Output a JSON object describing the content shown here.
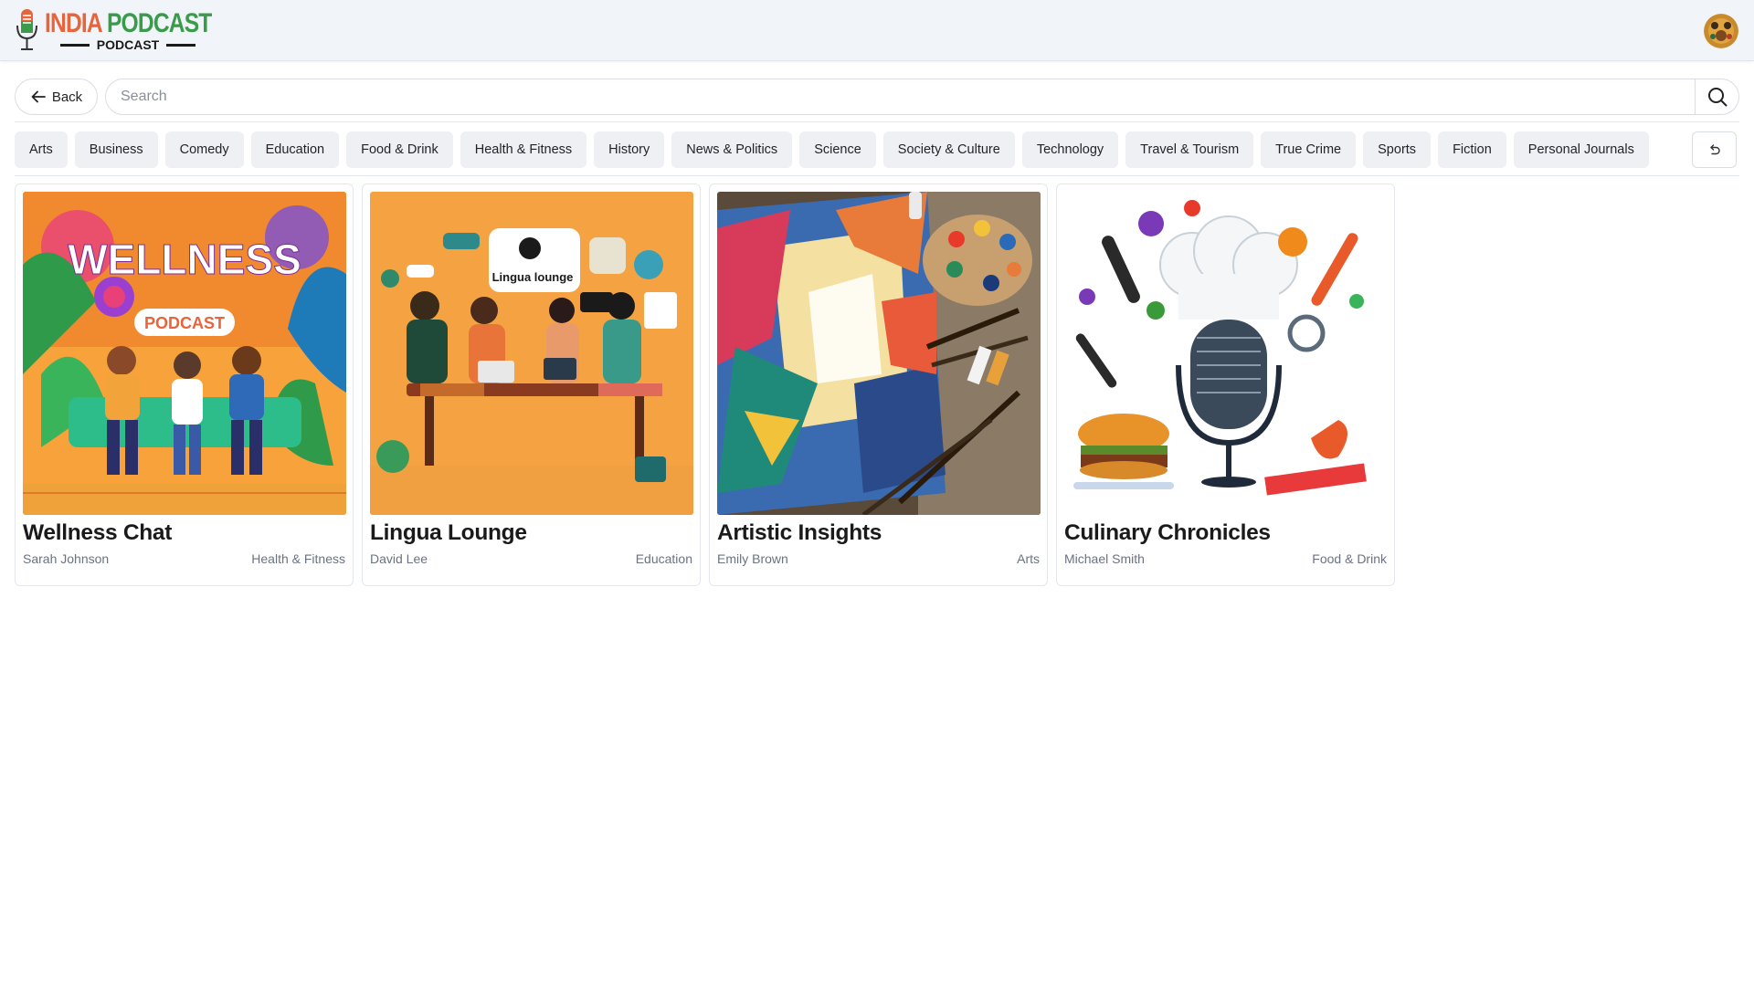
{
  "header": {
    "logo_title_part1": "INDIA ",
    "logo_title_part2": "PODCAST",
    "logo_subtitle": "PODCAST"
  },
  "toolbar": {
    "back_label": "Back",
    "search_placeholder": "Search",
    "search_value": ""
  },
  "categories": [
    "Arts",
    "Business",
    "Comedy",
    "Education",
    "Food & Drink",
    "Health & Fitness",
    "History",
    "News & Politics",
    "Science",
    "Society & Culture",
    "Technology",
    "Travel & Tourism",
    "True Crime",
    "Sports",
    "Fiction",
    "Personal Journals"
  ],
  "podcasts": [
    {
      "title": "Wellness Chat",
      "author": "Sarah Johnson",
      "category": "Health & Fitness",
      "cover_text": "WELLNESS",
      "cover_badge": "PODCAST"
    },
    {
      "title": "Lingua Lounge",
      "author": "David Lee",
      "category": "Education",
      "cover_text": "Lingua lounge"
    },
    {
      "title": "Artistic Insights",
      "author": "Emily Brown",
      "category": "Arts"
    },
    {
      "title": "Culinary Chronicles",
      "author": "Michael Smith",
      "category": "Food & Drink"
    }
  ],
  "colors": {
    "header_bg": "#f1f4f8",
    "chip_bg": "#eef0f3",
    "logo_orange": "#e8643a",
    "logo_green": "#3a9b4a"
  },
  "icons": {
    "back": "arrow-left-icon",
    "search": "search-icon",
    "reset": "reset-icon"
  }
}
